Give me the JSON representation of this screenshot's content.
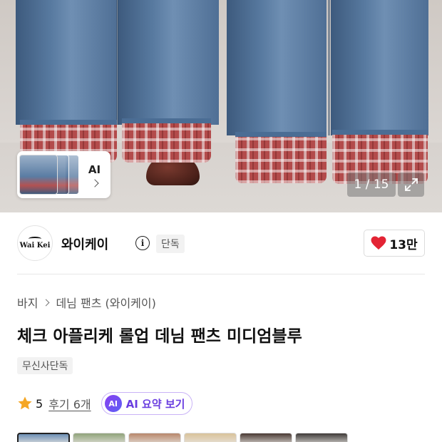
{
  "gallery": {
    "counter": "1 / 15",
    "ai_thumb_label": "AI",
    "icons": {
      "expand": "expand-icon",
      "chevron": "chevron-right-icon"
    }
  },
  "brand": {
    "logo_text": "Wai Kei",
    "name": "와이케이",
    "info_icon": "info-icon",
    "badge": "단독",
    "like_count": "13만",
    "like_icon": "heart-icon",
    "like_color": "#e32434"
  },
  "breadcrumb": {
    "items": [
      "바지",
      "데님 팬츠 (와이케이)"
    ]
  },
  "product": {
    "title": "체크 아플리케 롤업 데님 팬츠 미디엄블루",
    "tag": "무신사단독"
  },
  "rating": {
    "star_icon": "star-icon",
    "star_color": "#f5a623",
    "value": "5",
    "review_label": "후기 6개",
    "ai_badge": "AI",
    "ai_summary_label": "AI 요약 보기"
  },
  "swatches": {
    "colors": [
      "#6d8fb5",
      "#8fa37a",
      "#b8876b",
      "#d9c29a",
      "#4a3a34",
      "#3e3a38"
    ],
    "selected_index": 0
  }
}
